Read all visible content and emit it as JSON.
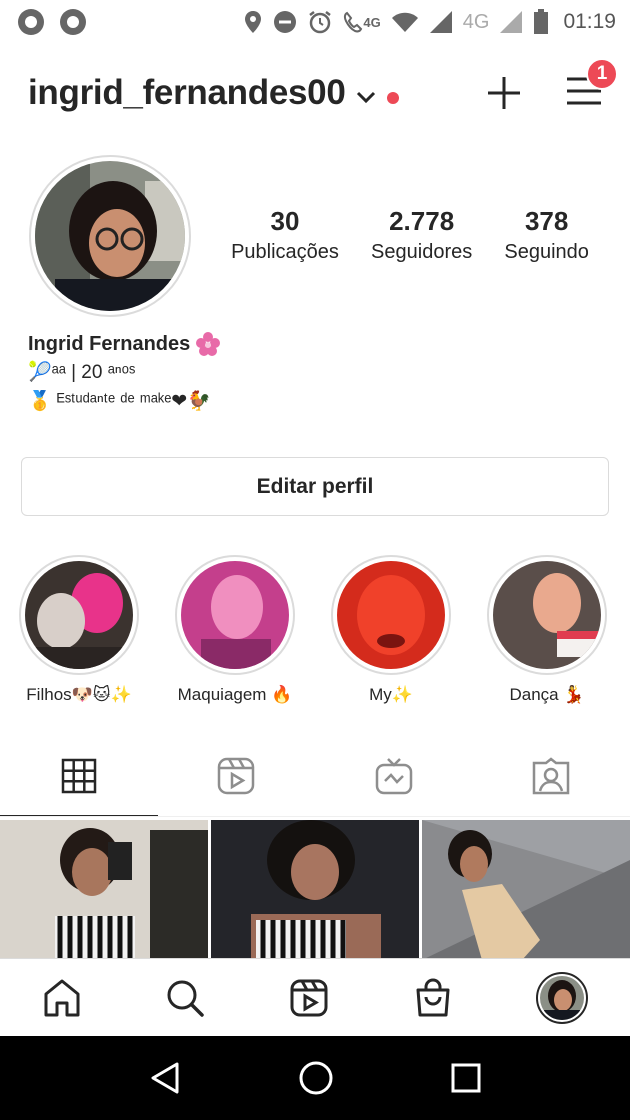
{
  "status_bar": {
    "time": "01:19",
    "network_small": "4G",
    "network_large": "4G",
    "icons": [
      "notification-dot-icon",
      "notification-dot-icon",
      "location-icon",
      "do-not-disturb-icon",
      "alarm-icon",
      "call-4g-icon",
      "wifi-icon",
      "signal-icon",
      "signal-icon",
      "battery-icon"
    ]
  },
  "header": {
    "username": "ingrid_fernandes00",
    "notification_count": "1",
    "icons": [
      "chevron-down-icon",
      "plus-icon",
      "menu-icon"
    ],
    "live_dot_color": "#ed4956"
  },
  "stats": [
    {
      "value": "30",
      "label": "Publicações"
    },
    {
      "value": "2.778",
      "label": "Seguidores"
    },
    {
      "value": "378",
      "label": "Seguindo"
    }
  ],
  "bio": {
    "name": "Ingrid Fernandes",
    "line1": "🎾ᵃᵃ  | 20 ᵃⁿᵒˢ",
    "line2": "🥇  ᴱˢᵗᵘᵈᵃⁿᵗᵉ ᵈᵉ ᵐᵃᵏᵉ❤🐓"
  },
  "edit_profile_label": "Editar perfil",
  "highlights": [
    {
      "label": "Filhos🐶🐱✨"
    },
    {
      "label": "Maquiagem 🔥"
    },
    {
      "label": "My✨"
    },
    {
      "label": "Dança 💃"
    }
  ],
  "tabs": [
    "grid-icon",
    "reels-icon",
    "igtv-icon",
    "tagged-icon"
  ],
  "bottom_nav": [
    "home-icon",
    "search-icon",
    "reels-icon",
    "shop-icon",
    "profile-avatar"
  ],
  "system_nav": [
    "back-icon",
    "home-icon",
    "recents-icon"
  ],
  "colors": {
    "accent_red": "#ed4956",
    "text": "#262626",
    "border": "#dbdbdb"
  }
}
